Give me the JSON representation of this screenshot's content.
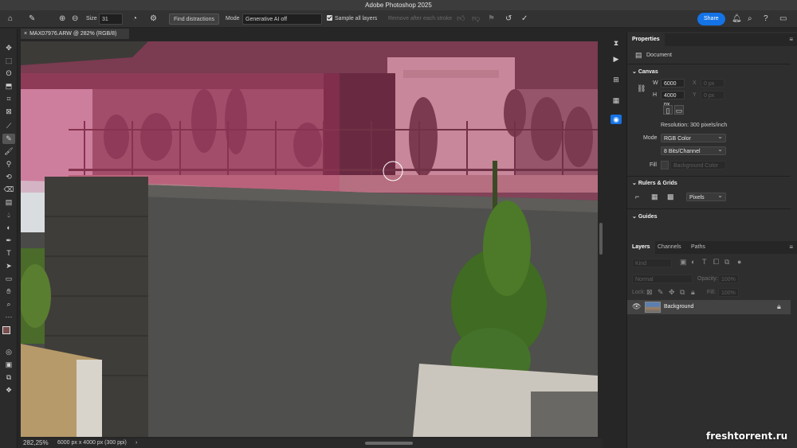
{
  "app": {
    "title": "Adobe Photoshop 2025"
  },
  "options": {
    "size_label": "Size",
    "size_value": "31",
    "find_distractions": "Find distractions",
    "mode_label": "Mode",
    "mode_value": "Generative AI off",
    "sample_all_layers": "Sample all layers",
    "remove_after_stroke": "Remove after each stroke",
    "share": "Share"
  },
  "document": {
    "tab": "MAX07976.ARW @ 282% (RGB/8)",
    "zoom": "282,25%",
    "info": "6000 px x 4000 px (300 ppi)"
  },
  "properties": {
    "tab": "Properties",
    "doc_type": "Document",
    "canvas_section": "Canvas",
    "w_label": "W",
    "w_value": "6000 px",
    "x_label": "X",
    "x_value": "0 px",
    "h_label": "H",
    "h_value": "4000 px",
    "y_label": "Y",
    "y_value": "0 px",
    "resolution": "Resolution: 300 pixels/inch",
    "mode_label": "Mode",
    "mode_value": "RGB Color",
    "depth_value": "8 Bits/Channel",
    "fill_label": "Fill",
    "fill_value": "Background Color",
    "rulers_section": "Rulers & Grids",
    "units_value": "Pixels",
    "guides_section": "Guides"
  },
  "layers": {
    "tabs": [
      "Layers",
      "Channels",
      "Paths"
    ],
    "kind_placeholder": "Kind",
    "blend": "Normal",
    "opacity_label": "Opacity:",
    "opacity_value": "100%",
    "lock_label": "Lock:",
    "fill_label": "Fill:",
    "fill_value": "100%",
    "items": [
      {
        "name": "Background"
      }
    ]
  },
  "watermark": "freshtorrent.ru",
  "colors": {
    "accent": "#1473e6",
    "mask_overlay": "#c83c6e"
  },
  "icons": {
    "tools": [
      "move-icon",
      "marquee-icon",
      "lasso-icon",
      "object-select-icon",
      "crop-icon",
      "frame-icon",
      "eyedropper-icon",
      "remove-tool-icon",
      "brush-icon",
      "stamp-icon",
      "history-brush-icon",
      "eraser-icon",
      "gradient-icon",
      "blur-icon",
      "dodge-icon",
      "pen-icon",
      "type-icon",
      "path-select-icon",
      "shape-icon",
      "hand-icon",
      "zoom-icon",
      "more-tools-icon"
    ]
  }
}
